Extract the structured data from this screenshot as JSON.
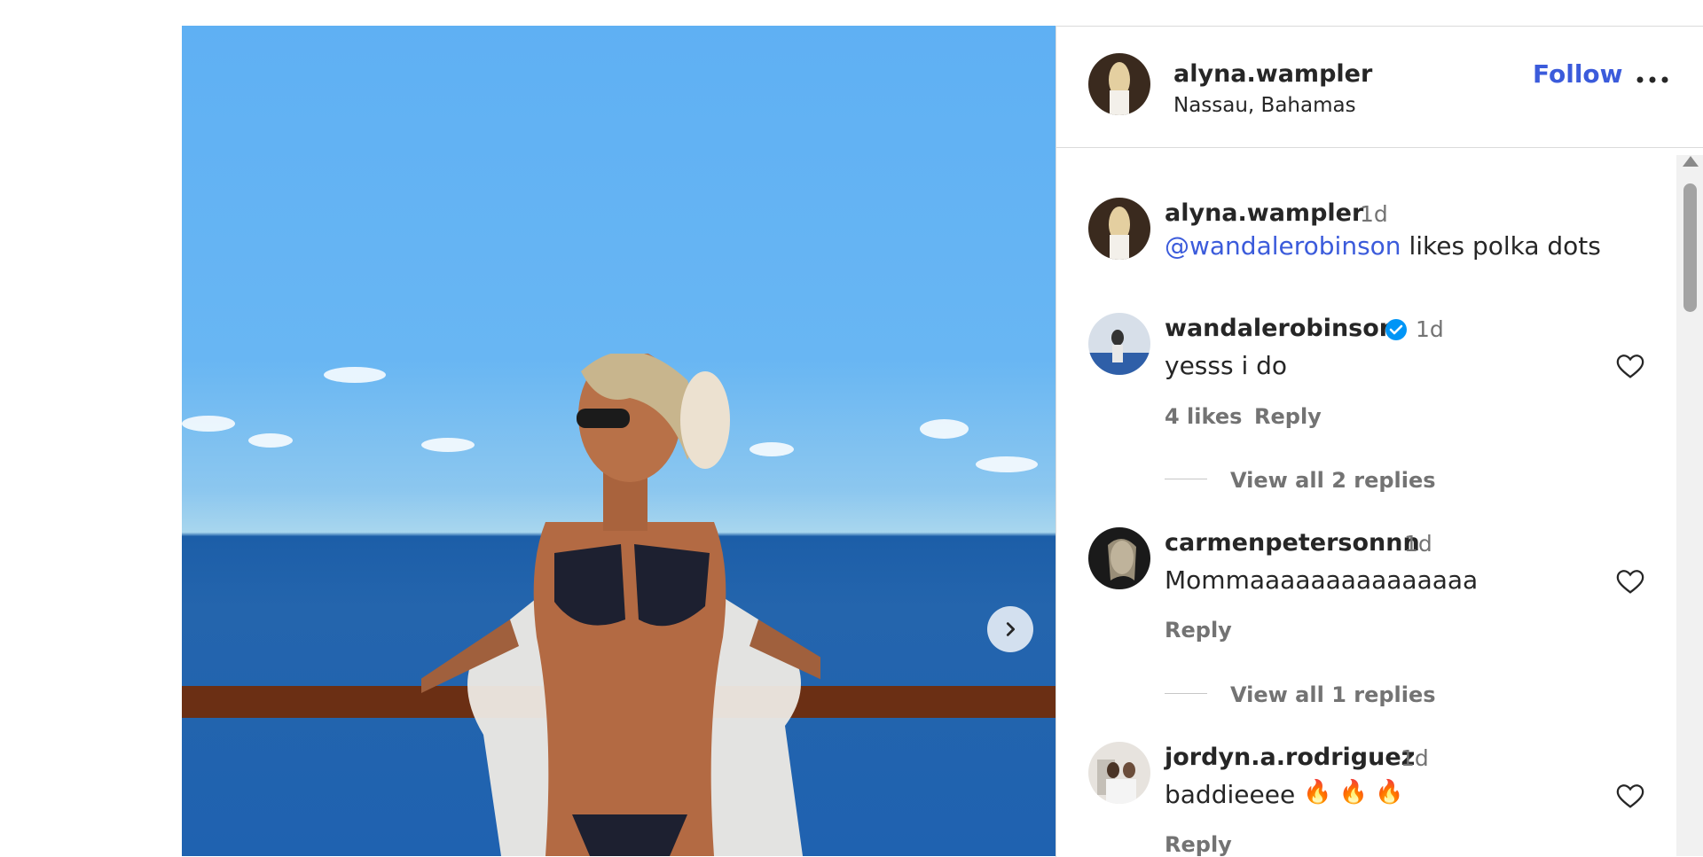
{
  "post_header": {
    "username": "alyna.wampler",
    "location": "Nassau, Bahamas",
    "follow_label": "Follow",
    "more_icon": "ellipsis-icon"
  },
  "comments": [
    {
      "username": "alyna.wampler",
      "time": "1d",
      "mention": "@wandalerobinson",
      "text": " likes polka dots"
    },
    {
      "username": "wandalerobinson",
      "verified": true,
      "time": "1d",
      "text": "yesss i do",
      "likes": "4 likes",
      "reply_label": "Reply",
      "view_replies": "View all 2 replies"
    },
    {
      "username": "carmenpetersonnn",
      "time": "1d",
      "text": "Mommaaaaaaaaaaaaaaa",
      "reply_label": "Reply",
      "view_replies": "View all 1 replies"
    },
    {
      "username": "jordyn.a.rodriguez",
      "time": "1d",
      "text": "baddieeee",
      "emojis": "🔥 🔥 🔥",
      "reply_label": "Reply"
    }
  ],
  "icons": {
    "next": "chevron-right-icon",
    "heart": "heart-outline-icon",
    "verified": "verified-badge-icon"
  },
  "colors": {
    "accent": "#3b5bdb",
    "verified": "#0095f6",
    "muted": "#737373"
  }
}
